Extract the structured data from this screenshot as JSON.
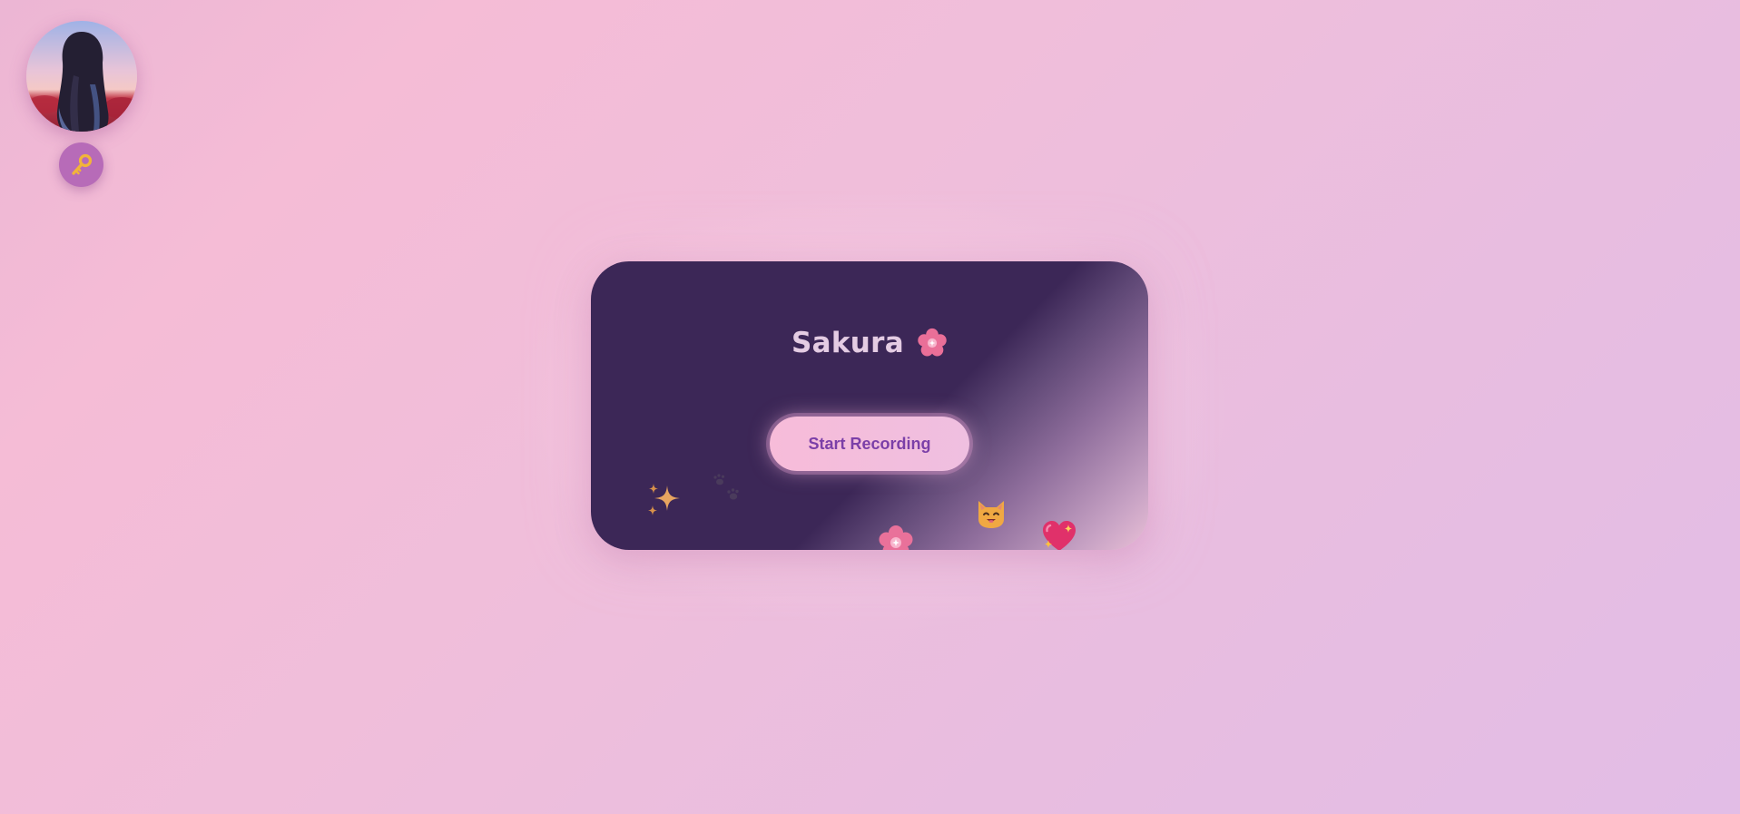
{
  "app": {
    "title": "Sakura"
  },
  "header": {
    "avatar_label": "profile-avatar",
    "key_icon": "key-icon"
  },
  "card": {
    "title": "Sakura",
    "title_icon": "cherry-blossom-icon",
    "record_button_label": "Start Recording",
    "decorations": [
      "sparkles-icon",
      "paw-prints-icon",
      "cherry-blossom-icon",
      "cat-face-icon",
      "sparkling-heart-icon"
    ]
  },
  "colors": {
    "background_start": "#f5bcd6",
    "background_end": "#e2bde6",
    "card_dark": "#3c2757",
    "card_light": "#e9bfd6",
    "button_bg": "#f7bcd9",
    "button_text": "#7b3fa8",
    "title_text": "#e4cce3",
    "key_button_bg": "#b76bb8"
  }
}
